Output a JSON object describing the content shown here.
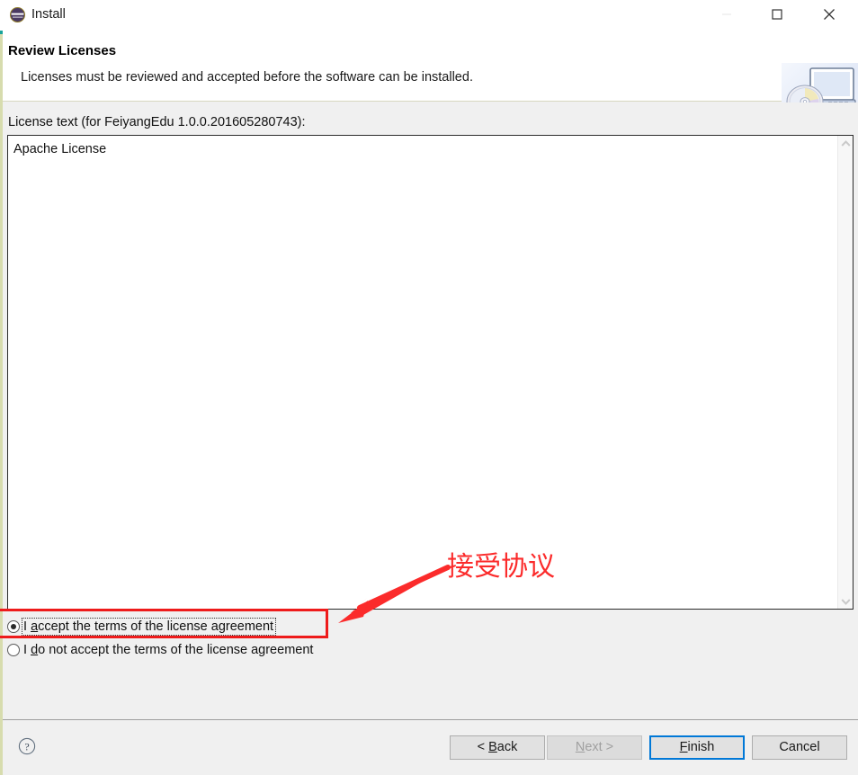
{
  "window": {
    "title": "Install",
    "app_icon": "eclipse-icon",
    "controls": {
      "minimize": "minimize-icon",
      "maximize": "maximize-icon",
      "close": "close-icon"
    }
  },
  "header": {
    "title": "Review Licenses",
    "description": "Licenses must be reviewed and accepted before the software can be installed.",
    "graphic": "installer-monitor-cd-icon"
  },
  "main": {
    "license_label": "License text (for FeiyangEdu 1.0.0.201605280743):",
    "license_label_mnemonic": "t",
    "license_text": "Apache License",
    "scrollbar": {
      "up_arrow": "chevron-up-icon",
      "down_arrow": "chevron-down-icon"
    },
    "radio_options": [
      {
        "label_prefix": "I ",
        "mnemonic": "a",
        "label_suffix": "ccept the terms of the license agreement",
        "full_label": "I accept the terms of the license agreement",
        "selected": true,
        "focused": true
      },
      {
        "label_prefix": "I ",
        "mnemonic": "d",
        "label_suffix": "o not accept the terms of the license agreement",
        "full_label": "I do not accept the terms of the license agreement",
        "selected": false,
        "focused": false
      }
    ]
  },
  "footer": {
    "help_icon": "help-question-icon",
    "buttons": [
      {
        "name": "back",
        "prefix": "< ",
        "mnemonic": "B",
        "suffix": "ack",
        "label": "< Back",
        "enabled": true,
        "default": false
      },
      {
        "name": "next",
        "prefix": "",
        "mnemonic": "N",
        "suffix": "ext >",
        "label": "Next >",
        "enabled": false,
        "default": false
      },
      {
        "name": "finish",
        "prefix": "",
        "mnemonic": "F",
        "suffix": "inish",
        "label": "Finish",
        "enabled": true,
        "default": true
      },
      {
        "name": "cancel",
        "prefix": "",
        "mnemonic": "",
        "suffix": "Cancel",
        "label": "Cancel",
        "enabled": true,
        "default": false
      }
    ]
  },
  "annotation": {
    "text": "接受协议",
    "color": "#fb2b2b",
    "highlight_target": "I accept the terms of the license agreement",
    "arrow": "red-arrow-down-left"
  },
  "colors": {
    "accent_focus": "#0078d7",
    "annotation_red": "#ee1b1b",
    "titlebar_bg": "#ffffff",
    "body_bg": "#f0f0f0",
    "edge_teal": "#18a39a",
    "edge_olive": "#d7dcae"
  }
}
